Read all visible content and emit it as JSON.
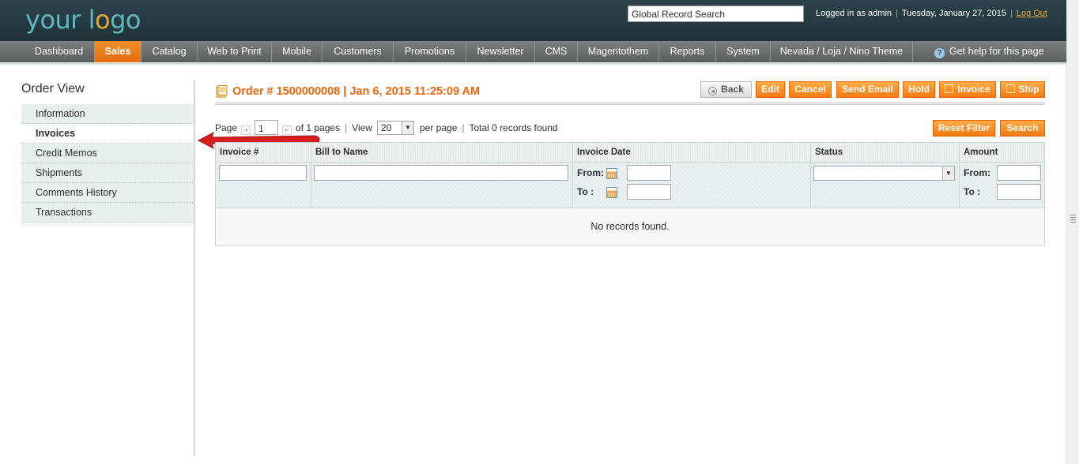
{
  "header": {
    "logo_prefix": "your l",
    "logo_o": "o",
    "logo_suffix": "go",
    "search_value": "Global Record Search",
    "logged_in": "Logged in as admin",
    "date": "Tuesday, January 27, 2015",
    "logout": "Log Out"
  },
  "nav": {
    "items": [
      "Dashboard",
      "Sales",
      "Catalog",
      "Web to Print",
      "Mobile",
      "Customers",
      "Promotions",
      "Newsletter",
      "CMS",
      "Magentothem",
      "Reports",
      "System",
      "Nevada / Loja / Nino Theme"
    ],
    "active": "Sales",
    "help": "Get help for this page"
  },
  "sidebar": {
    "title": "Order View",
    "items": [
      "Information",
      "Invoices",
      "Credit Memos",
      "Shipments",
      "Comments History",
      "Transactions"
    ],
    "active": "Invoices"
  },
  "order": {
    "title": "Order # 1500000008 | Jan 6, 2015 11:25:09 AM"
  },
  "buttons": {
    "back": "Back",
    "edit": "Edit",
    "cancel": "Cancel",
    "send_email": "Send Email",
    "hold": "Hold",
    "invoice": "Invoice",
    "ship": "Ship",
    "reset_filter": "Reset Filter",
    "search": "Search"
  },
  "pager": {
    "page_label": "Page",
    "page_value": "1",
    "of_pages": "of 1 pages",
    "view_label": "View",
    "view_value": "20",
    "per_page": "per page",
    "total": "Total 0 records found"
  },
  "grid": {
    "columns": [
      "Invoice #",
      "Bill to Name",
      "Invoice Date",
      "Status",
      "Amount"
    ],
    "from_label": "From:",
    "to_label": "To :",
    "empty_text": "No records found."
  },
  "colors": {
    "accent": "#e8670f",
    "header_bg": "#2b4349",
    "arrow": "#d81d1d"
  }
}
